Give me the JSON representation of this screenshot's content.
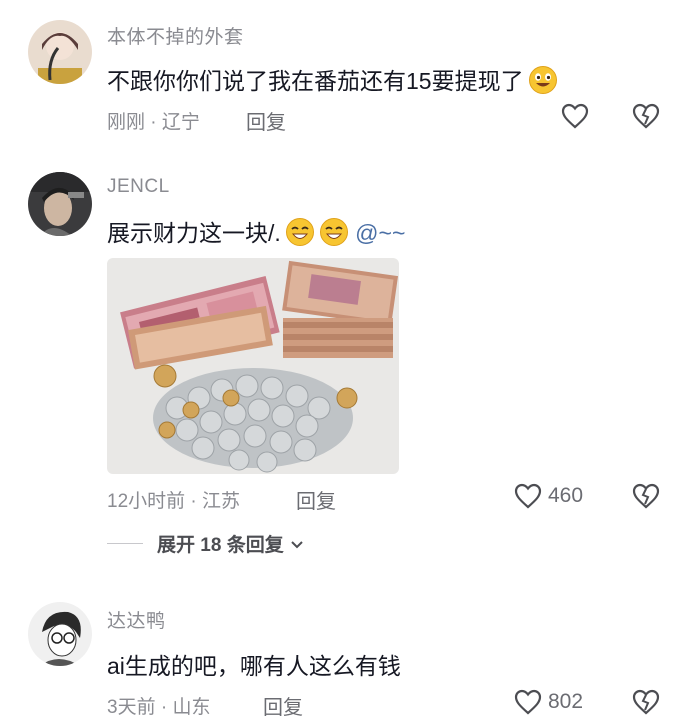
{
  "comments": [
    {
      "username": "本体不掉的外套",
      "text": "不跟你你们说了我在番茄还有15要提现了",
      "time": "刚刚",
      "location": "辽宁",
      "reply_label": "回复",
      "like_count": "",
      "emoji": "grinning-emoji"
    },
    {
      "username": "JENCL",
      "text": "展示财力这一块/.",
      "mention": "@~~",
      "time": "12小时前",
      "location": "江苏",
      "reply_label": "回复",
      "like_count": "460",
      "emoji": "grinning-emoji",
      "image": "photo of banknotes and coins"
    },
    {
      "username": "达达鸭",
      "text": "ai生成的吧，哪有人这么有钱",
      "time": "3天前",
      "location": "山东",
      "reply_label": "回复",
      "like_count": "802"
    }
  ],
  "expand_replies_label": "展开 18 条回复",
  "icons": {
    "like": "heart-outline-icon",
    "dislike": "broken-heart-icon",
    "chevron": "chevron-down-icon"
  },
  "colors": {
    "text": "#161823",
    "meta": "#8a8b91",
    "mention": "#4a6fa5",
    "background": "#ffffff"
  }
}
